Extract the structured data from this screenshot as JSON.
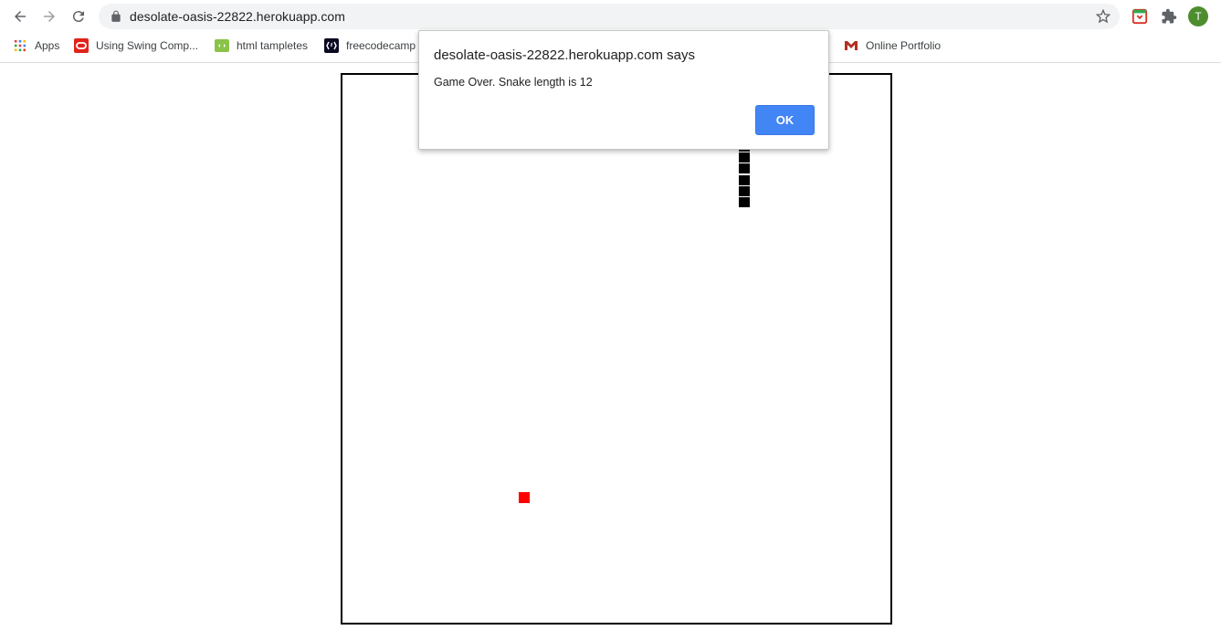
{
  "browser": {
    "url": "desolate-oasis-22822.herokuapp.com",
    "profile_initial": "T",
    "bookmarks": [
      {
        "label": "Apps",
        "icon": "apps-grid-icon"
      },
      {
        "label": "Using Swing Comp...",
        "icon": "oracle-icon"
      },
      {
        "label": "html tampletes",
        "icon": "html-templates-icon"
      },
      {
        "label": "freecodecamp",
        "icon": "freecodecamp-icon"
      },
      {
        "label": "Online Portfolio",
        "icon": "gmail-icon"
      }
    ]
  },
  "dialog": {
    "title": "desolate-oasis-22822.herokuapp.com says",
    "message": "Game Over. Snake length is 12",
    "ok_label": "OK"
  },
  "game": {
    "grid_size": 50,
    "snake_length": 12,
    "snake_color": "#000000",
    "food_color": "#ff0000",
    "board_border_color": "#000000"
  },
  "colors": {
    "ok_button": "#4285f4",
    "avatar": "#4e8d2e",
    "omnibox": "#f1f3f4"
  }
}
